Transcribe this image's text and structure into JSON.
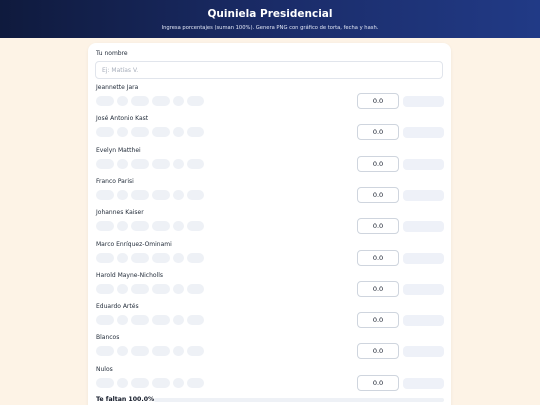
{
  "header": {
    "title": "Quiniela Presidencial",
    "subtitle": "Ingresa porcentajes (suman 100%). Genera PNG con gráfico de torta, fecha y hash."
  },
  "form": {
    "name_label": "Tu nombre",
    "name_placeholder": "Ej: Matías V.",
    "name_value": ""
  },
  "candidates": [
    {
      "name": "Jeannette Jara",
      "value": "0.0"
    },
    {
      "name": "José Antonio Kast",
      "value": "0.0"
    },
    {
      "name": "Evelyn Matthei",
      "value": "0.0"
    },
    {
      "name": "Franco Parisi",
      "value": "0.0"
    },
    {
      "name": "Johannes Kaiser",
      "value": "0.0"
    },
    {
      "name": "Marco Enríquez-Ominami",
      "value": "0.0"
    },
    {
      "name": "Harold Mayne-Nicholls",
      "value": "0.0"
    },
    {
      "name": "Eduardo Artés",
      "value": "0.0"
    },
    {
      "name": "Blancos",
      "value": "0.0"
    },
    {
      "name": "Nulos",
      "value": "0.0"
    }
  ],
  "summary": {
    "remaining_text": "Te faltan 100.0%",
    "progress_fraction": 0.0
  }
}
